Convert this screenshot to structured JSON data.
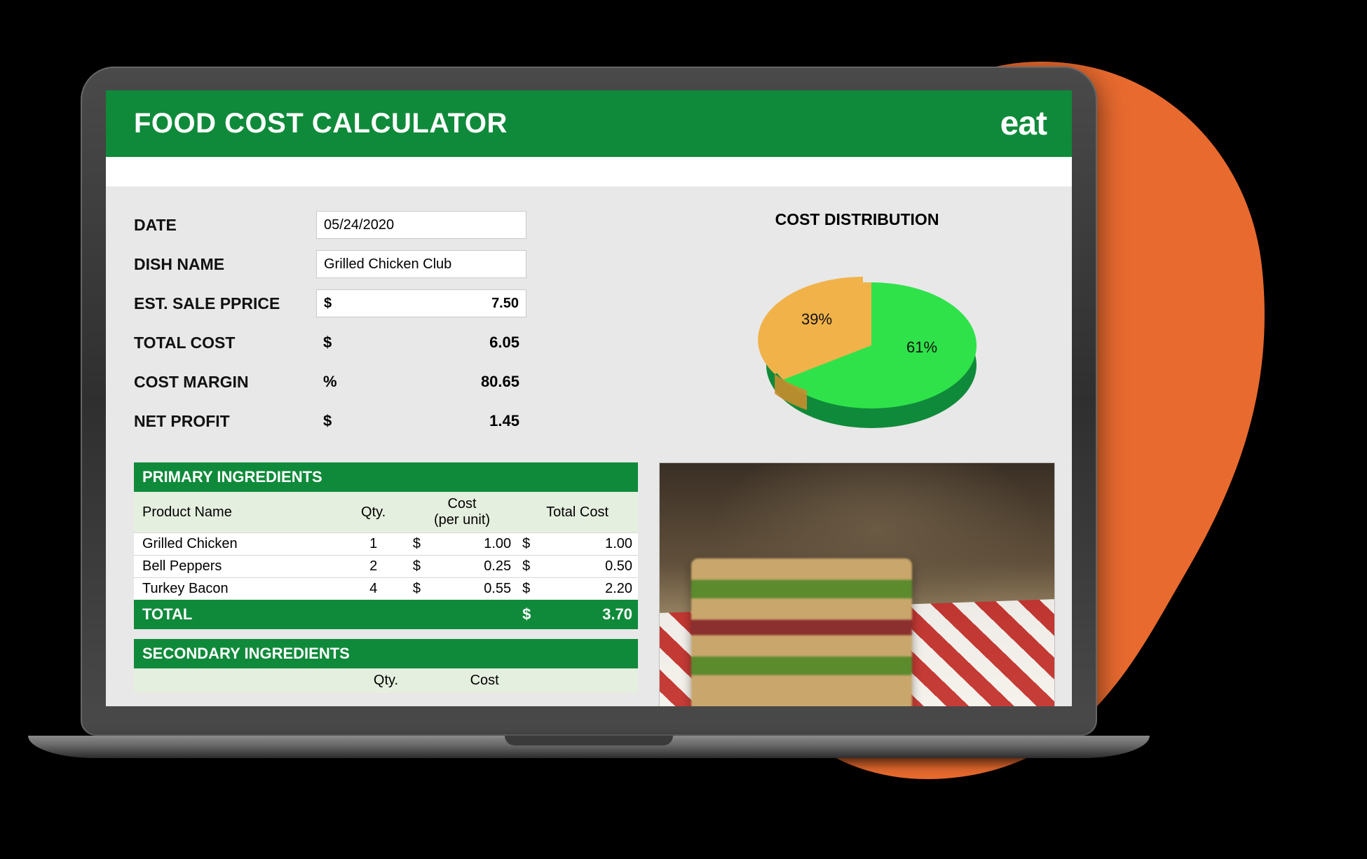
{
  "header": {
    "title": "FOOD COST CALCULATOR",
    "brand": "eat"
  },
  "form": {
    "date_label": "DATE",
    "date_value": "05/24/2020",
    "dish_label": "DISH NAME",
    "dish_value": "Grilled Chicken Club",
    "price_label": "EST. SALE PPRICE",
    "price_cur": "$",
    "price_value": "7.50",
    "total_cost_label": "TOTAL COST",
    "total_cost_cur": "$",
    "total_cost_value": "6.05",
    "margin_label": "COST MARGIN",
    "margin_cur": "%",
    "margin_value": "80.65",
    "profit_label": "NET PROFIT",
    "profit_cur": "$",
    "profit_value": "1.45"
  },
  "distribution": {
    "title": "COST DISTRIBUTION"
  },
  "chart_data": {
    "type": "pie",
    "title": "COST DISTRIBUTION",
    "series": [
      {
        "name": "Slice A",
        "value": 61,
        "label": "61%",
        "color": "#2fe24a"
      },
      {
        "name": "Slice B",
        "value": 39,
        "label": "39%",
        "color": "#f1b24a"
      }
    ]
  },
  "primary": {
    "section": "PRIMARY INGREDIENTS",
    "cols": {
      "name": "Product Name",
      "qty": "Qty.",
      "cost_line1": "Cost",
      "cost_line2": "(per unit)",
      "total": "Total Cost"
    },
    "rows": [
      {
        "name": "Grilled Chicken",
        "qty": "1",
        "unit_cur": "$",
        "unit": "1.00",
        "tot_cur": "$",
        "tot": "1.00"
      },
      {
        "name": "Bell Peppers",
        "qty": "2",
        "unit_cur": "$",
        "unit": "0.25",
        "tot_cur": "$",
        "tot": "0.50"
      },
      {
        "name": "Turkey Bacon",
        "qty": "4",
        "unit_cur": "$",
        "unit": "0.55",
        "tot_cur": "$",
        "tot": "2.20"
      }
    ],
    "total_label": "TOTAL",
    "total_cur": "$",
    "total_value": "3.70"
  },
  "secondary": {
    "section": "SECONDARY INGREDIENTS",
    "cols": {
      "qty": "Qty.",
      "cost": "Cost"
    }
  }
}
